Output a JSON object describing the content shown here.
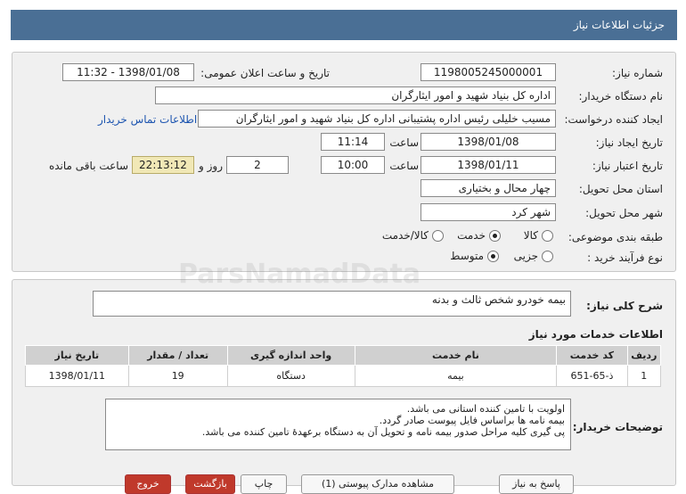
{
  "header": {
    "title": "جزئیات اطلاعات نیاز"
  },
  "form": {
    "need_number": {
      "label": "شماره نیاز:",
      "value": "1198005245000001"
    },
    "announce": {
      "label": "تاریخ و ساعت اعلان عمومی:",
      "value": "1398/01/08 - 11:32"
    },
    "buyer_org": {
      "label": "نام دستگاه خریدار:",
      "value": "اداره کل بنیاد شهید و امور ایثارگران"
    },
    "requester": {
      "label": "ایجاد کننده درخواست:",
      "value": "مسیب خلیلی رئیس اداره پشتیبانی اداره کل بنیاد شهید و امور ایثارگران"
    },
    "contact_link": "اطلاعات تماس خریدار",
    "created": {
      "label": "تاریخ ایجاد نیاز:",
      "date": "1398/01/08",
      "time_label": "ساعت",
      "time": "11:14"
    },
    "validity": {
      "label": "تاریخ اعتبار نیاز:",
      "date": "1398/01/11",
      "time_label": "ساعت",
      "time": "10:00",
      "days": "2",
      "days_label": "روز و",
      "remaining": "22:13:12",
      "remaining_label": "ساعت باقی مانده"
    },
    "province": {
      "label": "استان محل تحویل:",
      "value": "چهار محال و بختیاری"
    },
    "city": {
      "label": "شهر محل تحویل:",
      "value": "شهر کرد"
    },
    "category": {
      "label": "طبقه بندی موضوعی:",
      "options": [
        "کالا",
        "خدمت",
        "کالا/خدمت"
      ],
      "selected": "خدمت"
    },
    "process": {
      "label": "نوع فرآیند خرید :",
      "options": [
        "جزیی",
        "متوسط"
      ],
      "selected": "متوسط"
    }
  },
  "summary": {
    "label": "شرح کلی نیاز:",
    "value": "بیمه خودرو شخص ثالث و بدنه"
  },
  "services": {
    "title": "اطلاعات خدمات مورد نیاز",
    "columns": [
      "ردیف",
      "کد خدمت",
      "نام خدمت",
      "واحد اندازه گیری",
      "تعداد / مقدار",
      "تاریخ نیاز"
    ],
    "rows": [
      [
        "1",
        "ذ-65-651",
        "بیمه",
        "دستگاه",
        "19",
        "1398/01/11"
      ]
    ]
  },
  "buyer_notes": {
    "label": "توضیحات خریدار:",
    "lines": [
      "اولویت با تامین کننده استانی می باشد.",
      "بیمه نامه ها براساس فایل پیوست صادر گردد.",
      "پی گیری کلیه مراحل صدور بیمه نامه و تحویل آن به دستگاه برعهدۀ تامین کننده می باشد."
    ]
  },
  "buttons": {
    "reply": "پاسخ به نیاز",
    "attachments": "مشاهده مدارک پیوستی (1)",
    "print": "چاپ",
    "back": "بازگشت",
    "exit": "خروج"
  },
  "watermark": "ParsNamadData"
}
